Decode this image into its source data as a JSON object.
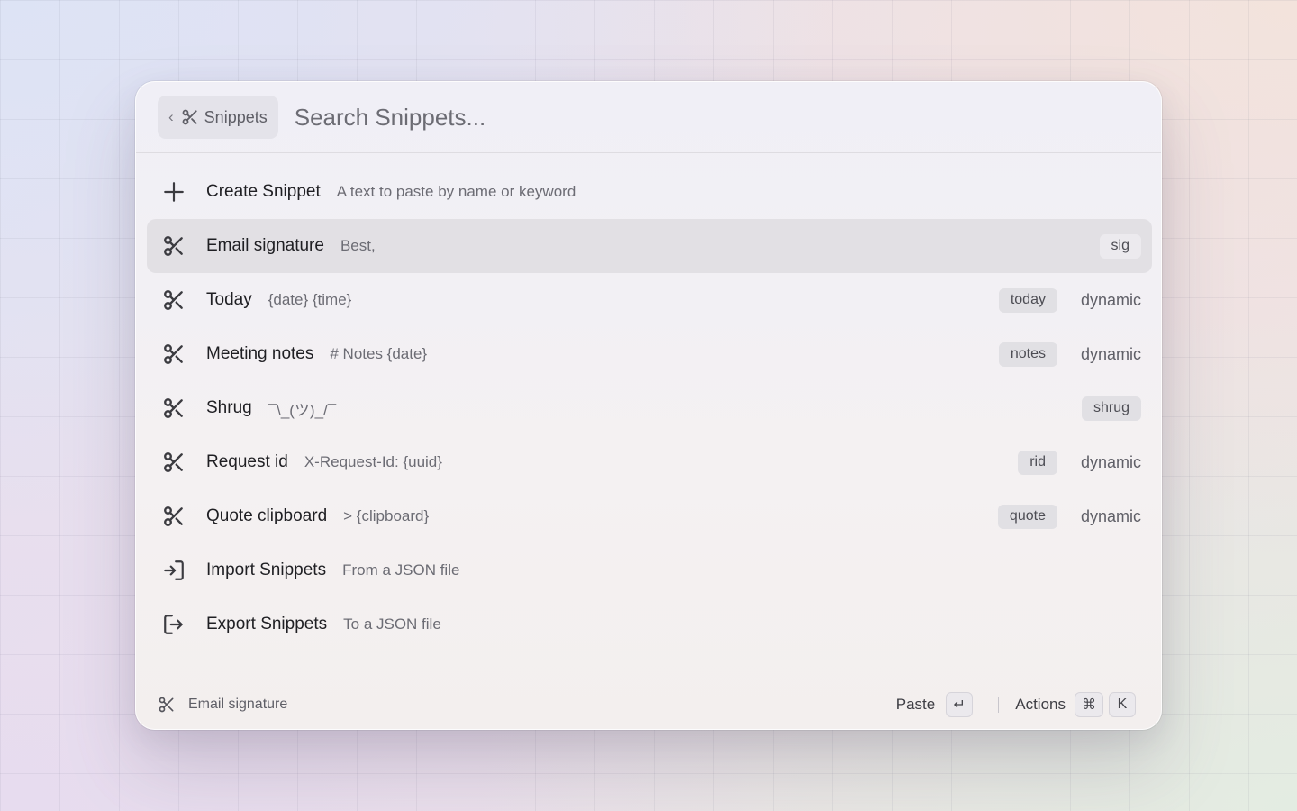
{
  "search": {
    "scope_label": "Snippets",
    "scope_chevron": "‹",
    "placeholder": "Search Snippets..."
  },
  "items": [
    {
      "icon": "plus-icon",
      "title": "Create Snippet",
      "subtitle": "A text to paste by name or keyword",
      "tag": "",
      "kind": ""
    },
    {
      "icon": "scissors-icon",
      "title": "Email signature",
      "subtitle": "Best,",
      "tag": "sig",
      "kind": "",
      "selected": true
    },
    {
      "icon": "scissors-icon",
      "title": "Today",
      "subtitle": "{date} {time}",
      "tag": "today",
      "kind": "dynamic"
    },
    {
      "icon": "scissors-icon",
      "title": "Meeting notes",
      "subtitle": "# Notes {date}",
      "tag": "notes",
      "kind": "dynamic"
    },
    {
      "icon": "scissors-icon",
      "title": "Shrug",
      "subtitle": "¯\\_(ツ)_/¯",
      "tag": "shrug",
      "kind": ""
    },
    {
      "icon": "scissors-icon",
      "title": "Request id",
      "subtitle": "X-Request-Id: {uuid}",
      "tag": "rid",
      "kind": "dynamic"
    },
    {
      "icon": "scissors-icon",
      "title": "Quote clipboard",
      "subtitle": "> {clipboard}",
      "tag": "quote",
      "kind": "dynamic"
    },
    {
      "icon": "import-icon",
      "title": "Import Snippets",
      "subtitle": "From a JSON file",
      "tag": "",
      "kind": ""
    },
    {
      "icon": "export-icon",
      "title": "Export Snippets",
      "subtitle": "To a JSON file",
      "tag": "",
      "kind": ""
    }
  ],
  "footer": {
    "selected_name": "Email signature",
    "paste_label": "Paste",
    "paste_key": "↵",
    "actions_label": "Actions",
    "actions_keys": [
      "⌘",
      "K"
    ]
  }
}
